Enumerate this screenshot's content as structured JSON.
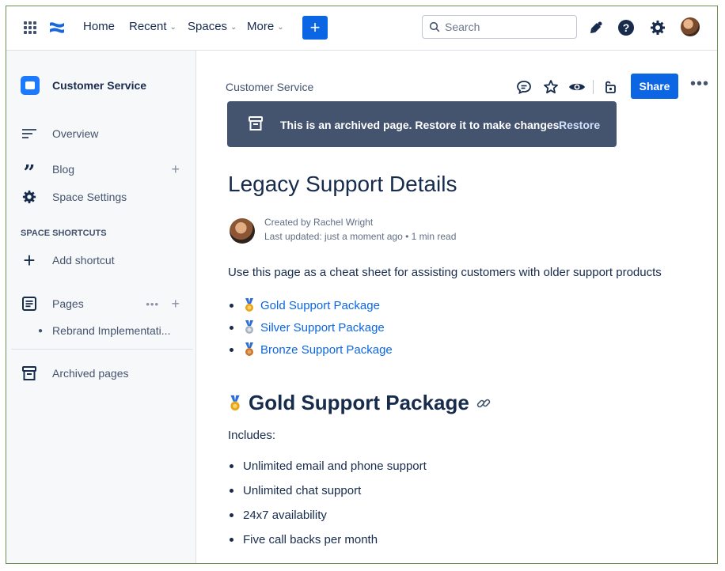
{
  "topnav": {
    "links": [
      {
        "label": "Home",
        "chevron": false
      },
      {
        "label": "Recent",
        "chevron": true
      },
      {
        "label": "Spaces",
        "chevron": true
      },
      {
        "label": "More",
        "chevron": true
      }
    ],
    "create_label": "+",
    "search_placeholder": "Search",
    "icons": [
      "apps-grid-icon",
      "confluence-logo-icon",
      "notifications-icon",
      "help-icon",
      "settings-icon",
      "user-avatar"
    ]
  },
  "sidebar": {
    "space_name": "Customer Service",
    "items": [
      {
        "label": "Overview",
        "icon": "overview-icon"
      },
      {
        "label": "Blog",
        "icon": "quote-icon"
      },
      {
        "label": "Space Settings",
        "icon": "gear-icon"
      }
    ],
    "shortcuts_heading": "SPACE SHORTCUTS",
    "add_shortcut": "Add shortcut",
    "pages_label": "Pages",
    "page_children": [
      "Rebrand Implementati..."
    ],
    "archived_label": "Archived pages"
  },
  "page": {
    "breadcrumb": "Customer Service",
    "share_label": "Share",
    "banner_text": "This is an archived page. Restore it to make changes.",
    "banner_action": "Restore",
    "title": "Legacy Support Details",
    "created_by": "Created by Rachel Wright",
    "last_updated": "Last updated: just a moment ago",
    "read_time": "1 min read",
    "intro": "Use this page as a cheat sheet for assisting customers with older support products",
    "toc": [
      {
        "label": "Gold Support Package",
        "medal": "#e8a317"
      },
      {
        "label": "Silver Support Package",
        "medal": "#a9b4c2"
      },
      {
        "label": "Bronze Support Package",
        "medal": "#c9772e"
      }
    ],
    "section_heading": "Gold Support Package",
    "includes_label": "Includes:",
    "features": [
      "Unlimited email and phone support",
      "Unlimited chat support",
      "24x7 availability",
      "Five call backs per month"
    ]
  },
  "colors": {
    "brand_blue": "#0c66e4",
    "banner_bg": "#44546f",
    "text": "#172b4d"
  }
}
